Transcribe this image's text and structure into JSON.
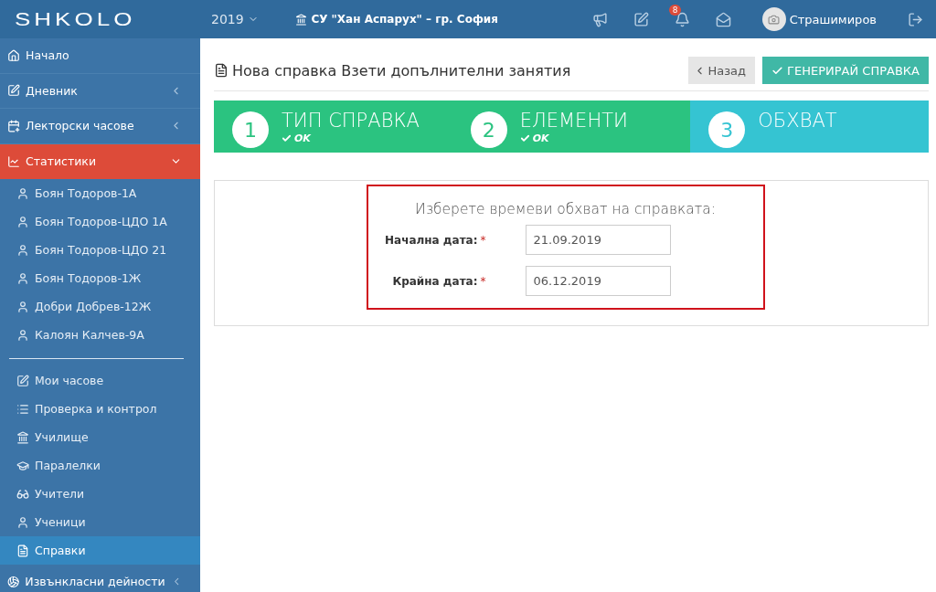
{
  "topbar": {
    "logo": "SHKOLO",
    "year": "2019",
    "school": "СУ \"Хан Аспарух\" – гр. София",
    "notifications_badge": "8",
    "user": "Страшимиров"
  },
  "sidebar": {
    "items": [
      {
        "kind": "menu",
        "label": "Начало",
        "selected": false
      },
      {
        "kind": "menu",
        "label": "Дневник",
        "selected": false,
        "expanded": false
      },
      {
        "kind": "menu",
        "label": "Лекторски часове",
        "selected": false,
        "expanded": false
      },
      {
        "kind": "menu",
        "label": "Статистики",
        "selected": true,
        "expanded": true,
        "children": [
          {
            "label": "Боян Тодоров-1А",
            "selected": false
          },
          {
            "label": "Боян Тодоров-ЦДО 1А",
            "selected": false
          },
          {
            "label": "Боян Тодоров-ЦДО 21",
            "selected": false
          },
          {
            "label": "Боян Тодоров-1Ж",
            "selected": false
          },
          {
            "label": "Добри Добрев-12Ж",
            "selected": false
          },
          {
            "label": "Калоян Калчев-9А",
            "selected": false
          }
        ]
      },
      {
        "kind": "divider"
      },
      {
        "kind": "sub",
        "label": "Мои часове",
        "selected": false
      },
      {
        "kind": "sub",
        "label": "Проверка и контрол",
        "selected": false
      },
      {
        "kind": "sub",
        "label": "Училище",
        "selected": false
      },
      {
        "kind": "sub",
        "label": "Паралелки",
        "selected": false
      },
      {
        "kind": "sub",
        "label": "Учители",
        "selected": false
      },
      {
        "kind": "sub",
        "label": "Ученици",
        "selected": false
      },
      {
        "kind": "sub",
        "label": "Справки",
        "selected": true
      },
      {
        "kind": "menu",
        "label": "Извънкласни дейности",
        "selected": false,
        "expanded": false
      }
    ]
  },
  "page": {
    "title": "Нова справка Взети допълнителни занятия",
    "back_button": "Назад",
    "generate_button": "ГЕНЕРИРАЙ СПРАВКА"
  },
  "steps": [
    {
      "number": "1",
      "title": "ТИП СПРАВКА",
      "status": "OK",
      "done": true
    },
    {
      "number": "2",
      "title": "ЕЛЕМЕНТИ",
      "status": "OK",
      "done": true
    },
    {
      "number": "3",
      "title": "ОБХВАТ",
      "done": false
    }
  ],
  "form": {
    "heading": "Изберете времеви обхват на справката:",
    "fields": [
      {
        "label": "Начална дата:",
        "required_mark": "*",
        "value": "21.09.2019"
      },
      {
        "label": "Крайна дата:",
        "required_mark": "*",
        "value": "06.12.2019"
      }
    ]
  }
}
